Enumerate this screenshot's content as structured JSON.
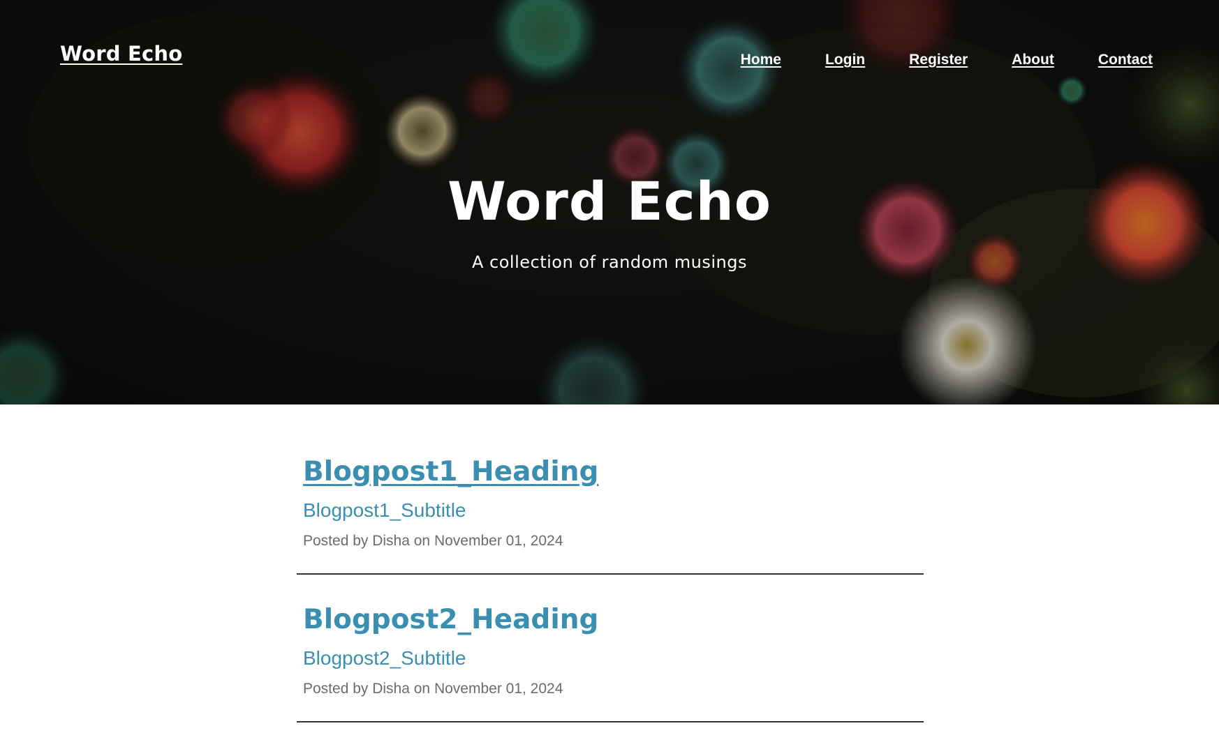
{
  "navbar": {
    "brand": "Word Echo",
    "links": [
      "Home",
      "Login",
      "Register",
      "About",
      "Contact"
    ]
  },
  "hero": {
    "title": "Word Echo",
    "subtitle": "A collection of  random musings"
  },
  "posts": [
    {
      "heading": "Blogpost1_Heading",
      "subtitle": "Blogpost1_Subtitle",
      "meta": "Posted by Disha on November 01, 2024"
    },
    {
      "heading": "Blogpost2_Heading",
      "subtitle": "Blogpost2_Subtitle",
      "meta": "Posted by Disha on November 01, 2024"
    }
  ],
  "colors": {
    "accent": "#3a8fb0",
    "meta_text": "#6b6b6b",
    "divider": "#333333"
  }
}
